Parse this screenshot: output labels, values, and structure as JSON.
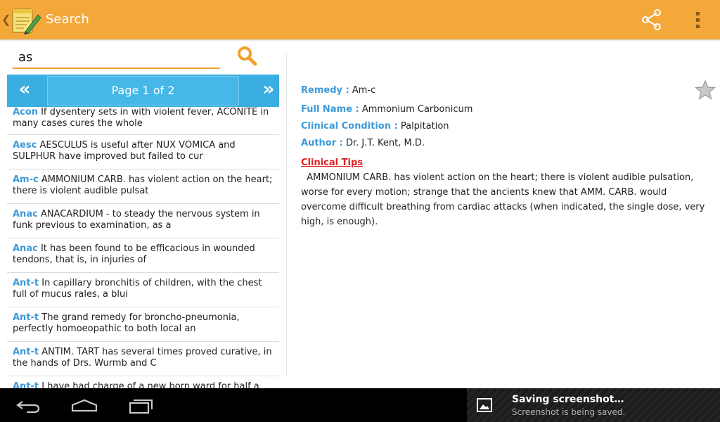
{
  "actionbar": {
    "title": "Search",
    "up_icon": "chevron-left-icon",
    "app_icon": "notepad-pencil-icon",
    "share_icon": "share-icon",
    "overflow_icon": "overflow-menu-icon",
    "color": "#f5a83a"
  },
  "search": {
    "value": "as",
    "button_icon": "search-icon"
  },
  "pager": {
    "prev_label": "«",
    "page_label": "Page 1 of 2",
    "next_label": "»",
    "color": "#3aaee0"
  },
  "results": [
    {
      "abbr": "Acon",
      "text": "If dysentery sets in with violent fever, ACONITE in many cases cures the whole"
    },
    {
      "abbr": "Aesc",
      "text": "AESCULUS is useful after NUX VOMICA and SULPHUR have improved but failed to cur"
    },
    {
      "abbr": "Am-c",
      "text": "AMMONIUM CARB. has violent action on the heart; there is violent audible pulsat"
    },
    {
      "abbr": "Anac",
      "text": "ANACARDIUM - to steady the nervous system in funk previous to examination, as a"
    },
    {
      "abbr": "Anac",
      "text": "It has been found to be efficacious in wounded tendons, that is, in injuries of"
    },
    {
      "abbr": "Ant-t",
      "text": "In capillary bronchitis of children, with the chest full of mucus rales, a blui"
    },
    {
      "abbr": "Ant-t",
      "text": "The grand remedy for broncho-pneumonia, perfectly homoeopathic to both local an"
    },
    {
      "abbr": "Ant-t",
      "text": "ANTIM. TART has several times proved curative, in the hands of Drs. Wurmb and C"
    },
    {
      "abbr": "Ant-t",
      "text": "I have had charge of a new born ward for half a"
    }
  ],
  "detail": {
    "remedy_label": "Remedy :",
    "remedy": "Am-c",
    "fullname_label": "Full Name :",
    "fullname": "Ammonium Carbonicum",
    "condition_label": "Clinical Condition :",
    "condition": "Palpitation",
    "author_label": "Author :",
    "author": "Dr. J.T. Kent, M.D.",
    "favorite_icon": "star-icon",
    "tips_title": "Clinical Tips",
    "tips_text": "AMMONIUM CARB. has violent action on the heart; there is violent audible pulsation, worse for every motion; strange that the ancients knew that AMM. CARB. would overcome difficult breathing from cardiac attacks (when indicated, the single dose, very high, is enough).",
    "label_color": "#3d9ad8",
    "tips_color": "#e02020"
  },
  "systembar": {
    "back_icon": "back-icon",
    "home_icon": "home-icon",
    "recents_icon": "recent-apps-icon",
    "notification": {
      "icon": "image-icon",
      "title": "Saving screenshot…",
      "text": "Screenshot is being saved."
    }
  }
}
